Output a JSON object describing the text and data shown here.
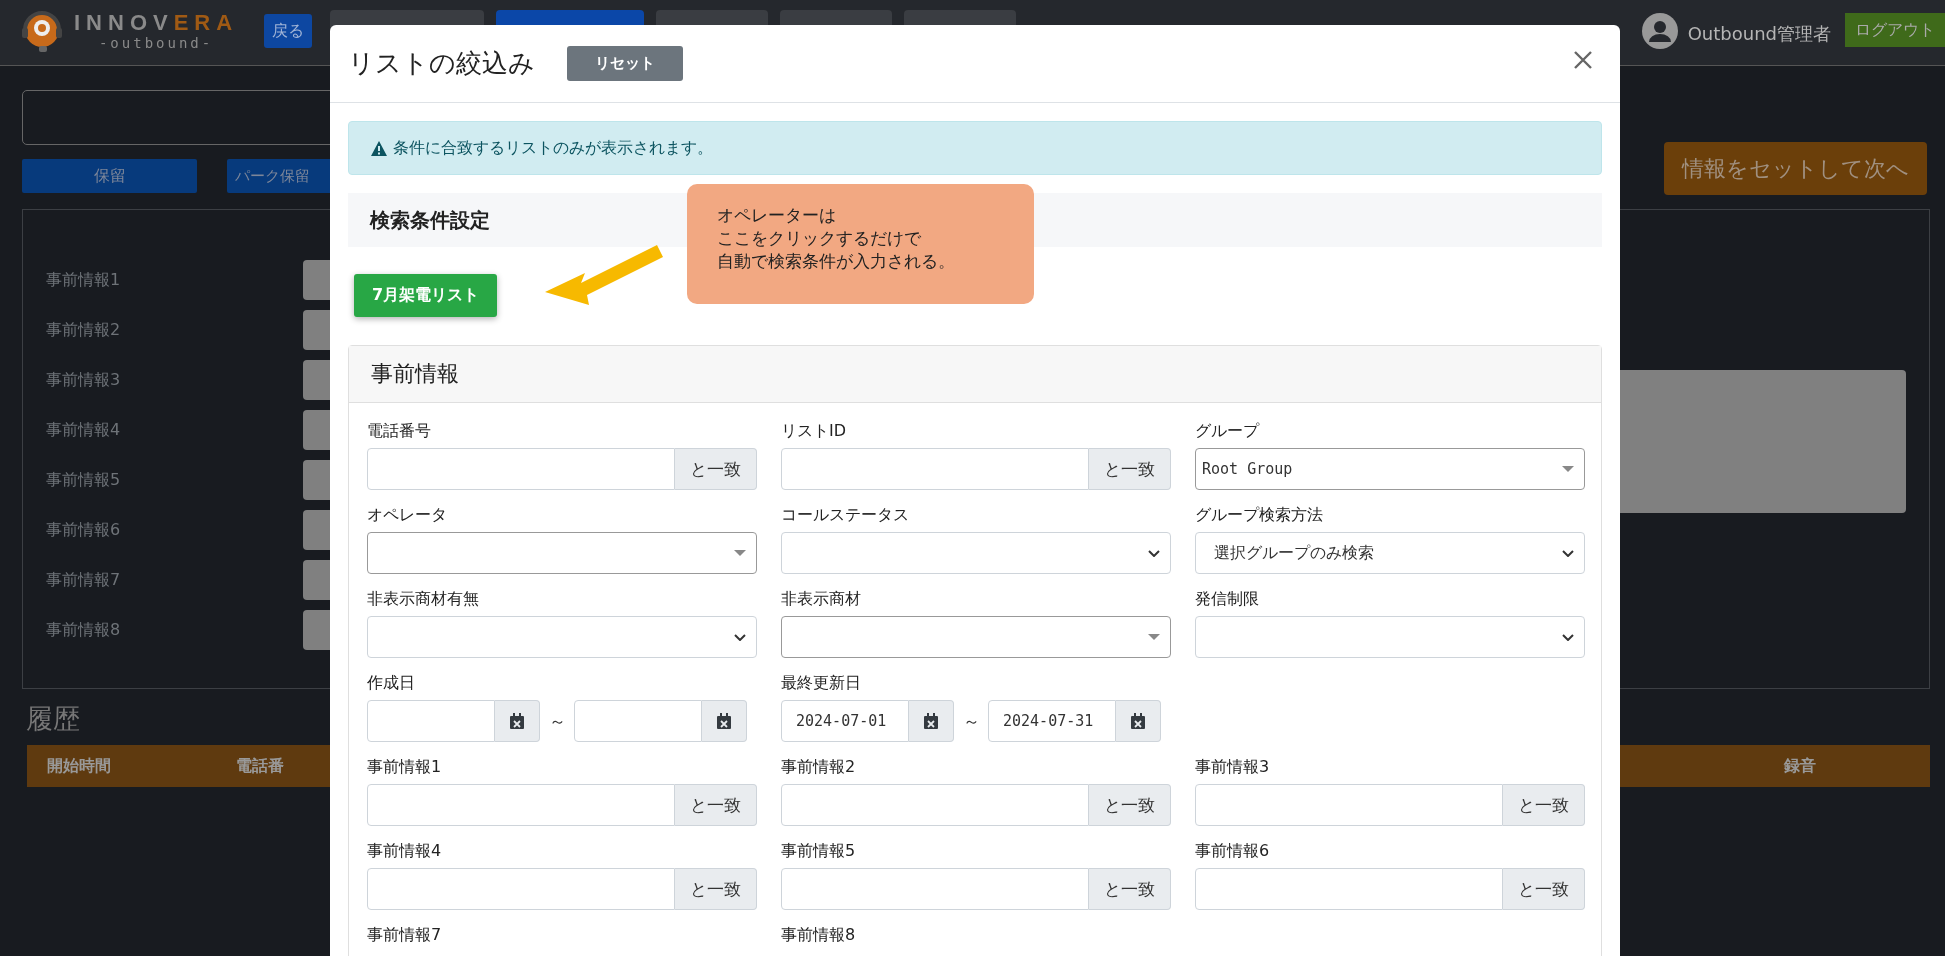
{
  "header": {
    "logo": {
      "main": "INNOV",
      "accent": "ERA",
      "sub": "-outbound-"
    },
    "back_button": "戻る",
    "nav_buttons": [
      {
        "color": "#3a3d42"
      },
      {
        "color": "#0b47a8"
      },
      {
        "color": "#3a3d42"
      },
      {
        "color": "#3a3d42"
      },
      {
        "color": "#3a3d42"
      }
    ],
    "user": "Outbound管理者",
    "logout_button": "ログアウト"
  },
  "background": {
    "hold_buttons": [
      "保留",
      "パーク保留"
    ],
    "next_button": "情報をセットして次へ",
    "info_labels": [
      "事前情報1",
      "事前情報2",
      "事前情報3",
      "事前情報4",
      "事前情報5",
      "事前情報6",
      "事前情報7",
      "事前情報8"
    ],
    "history": {
      "title": "履歴",
      "columns": [
        "開始時間",
        "電話番",
        "録音"
      ]
    }
  },
  "modal": {
    "title": "リストの絞込み",
    "reset_button": "リセット",
    "alert": "条件に合致するリストのみが表示されます。",
    "section_title": "検索条件設定",
    "preset_button": "7月架電リスト",
    "callout": [
      "オペレーターは",
      "ここをクリックするだけで",
      "自動で検索条件が入力される。"
    ],
    "card_title": "事前情報",
    "fields": [
      {
        "kind": "match",
        "label": "電話番号",
        "suffix": "と一致"
      },
      {
        "kind": "match",
        "label": "リストID",
        "suffix": "と一致"
      },
      {
        "kind": "select2",
        "label": "グループ",
        "value": "Root Group"
      },
      {
        "kind": "select2",
        "label": "オペレータ"
      },
      {
        "kind": "select",
        "label": "コールステータス"
      },
      {
        "kind": "select",
        "label": "グループ検索方法",
        "value": "選択グループのみ検索"
      },
      {
        "kind": "select",
        "label": "非表示商材有無"
      },
      {
        "kind": "select2",
        "label": "非表示商材"
      },
      {
        "kind": "select",
        "label": "発信制限"
      },
      {
        "kind": "daterange",
        "label": "作成日",
        "separator": "～"
      },
      {
        "kind": "daterange",
        "label": "最終更新日",
        "from": "2024-07-01",
        "to": "2024-07-31",
        "separator": "～"
      },
      {
        "kind": "empty"
      },
      {
        "kind": "match",
        "label": "事前情報1",
        "suffix": "と一致"
      },
      {
        "kind": "match",
        "label": "事前情報2",
        "suffix": "と一致"
      },
      {
        "kind": "match",
        "label": "事前情報3",
        "suffix": "と一致"
      },
      {
        "kind": "match",
        "label": "事前情報4",
        "suffix": "と一致"
      },
      {
        "kind": "match",
        "label": "事前情報5",
        "suffix": "と一致"
      },
      {
        "kind": "match",
        "label": "事前情報6",
        "suffix": "と一致"
      },
      {
        "kind": "label",
        "label": "事前情報7"
      },
      {
        "kind": "label",
        "label": "事前情報8"
      }
    ]
  }
}
